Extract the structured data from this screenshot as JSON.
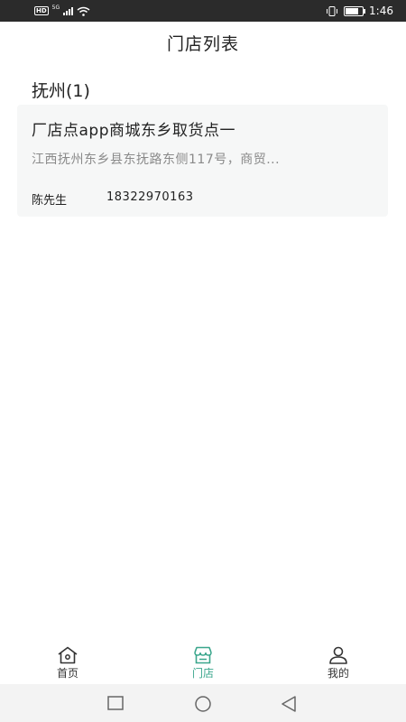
{
  "status_bar": {
    "network_hd": "HD",
    "network_type": "5G",
    "time": "1:46",
    "battery_level": 0.85
  },
  "header": {
    "title": "门店列表"
  },
  "groups": [
    {
      "city": "抚州(1)",
      "stores": [
        {
          "name": "厂店点app商城东乡取货点一",
          "address": "江西抚州东乡县东抚路东侧117号，商贸...",
          "contact_name": "陈先生",
          "contact_phone": "18322970163"
        }
      ]
    }
  ],
  "tabbar": {
    "items": [
      {
        "label": "首页",
        "icon": "home-icon",
        "active": false
      },
      {
        "label": "门店",
        "icon": "store-icon",
        "active": true
      },
      {
        "label": "我的",
        "icon": "user-icon",
        "active": false
      }
    ],
    "active_color": "#3aa68c"
  },
  "system_nav": {
    "icons": [
      "recent-apps-icon",
      "home-circle-icon",
      "back-triangle-icon"
    ]
  }
}
